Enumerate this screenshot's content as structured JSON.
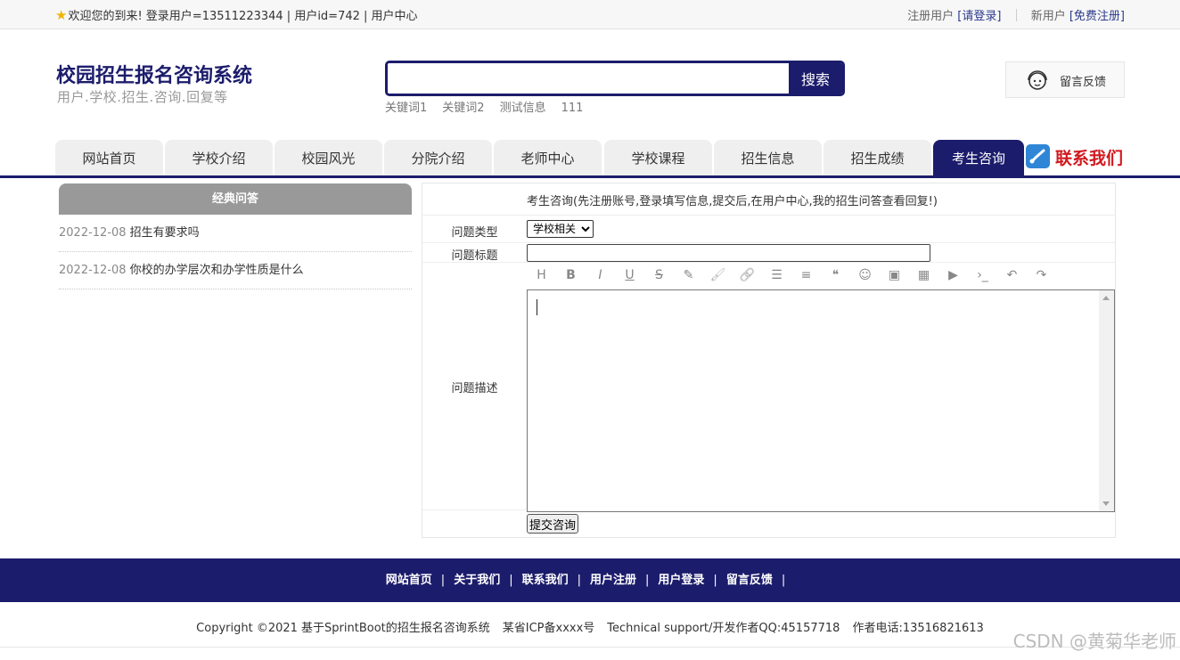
{
  "topbar": {
    "welcome": "欢迎您的到来!  登录用户=13511223344 | 用户id=742 | 用户中心",
    "register_prefix": "注册用户",
    "login_link": "[请登录]",
    "new_user_prefix": "新用户",
    "register_link": "[免费注册]"
  },
  "header": {
    "title": "校园招生报名咨询系统",
    "subtitle": "用户.学校.招生.咨询.回复等",
    "search_button": "搜索",
    "search_value": "",
    "keywords": [
      "关键词1",
      "关键词2",
      "测试信息",
      "111"
    ],
    "feedback_label": "留言反馈"
  },
  "nav": {
    "tabs": [
      "网站首页",
      "学校介绍",
      "校园风光",
      "分院介绍",
      "老师中心",
      "学校课程",
      "招生信息",
      "招生成绩",
      "考生咨询"
    ],
    "active_index": 8,
    "contact_label": "联系我们"
  },
  "sidebar": {
    "heading": "经典问答",
    "items": [
      {
        "date": "2022-12-08",
        "question": "招生有要求吗"
      },
      {
        "date": "2022-12-08",
        "question": "你校的办学层次和办学性质是什么"
      }
    ]
  },
  "form": {
    "intro": "考生咨询(先注册账号,登录填写信息,提交后,在用户中心,我的招生问答查看回复!)",
    "type_label": "问题类型",
    "type_value": "学校相关",
    "title_label": "问题标题",
    "title_value": "",
    "desc_label": "问题描述",
    "toolbar_icons": [
      "heading-icon",
      "bold-icon",
      "italic-icon",
      "underline-icon",
      "strikethrough-icon",
      "highlight-icon",
      "paint-brush-icon",
      "link-icon",
      "unordered-list-icon",
      "align-icon",
      "quote-icon",
      "emoji-icon",
      "image-icon",
      "table-icon",
      "video-icon",
      "code-icon",
      "undo-icon",
      "redo-icon"
    ],
    "toolbar_glyphs": [
      "H",
      "B",
      "I",
      "U",
      "S",
      "✎",
      "🖌",
      "🔗",
      "☰",
      "≡",
      "❝",
      "☺",
      "▣",
      "▦",
      "▶",
      "›_",
      "↶",
      "↷"
    ],
    "submit_label": "提交咨询"
  },
  "footer": {
    "links": [
      "网站首页",
      "关于我们",
      "联系我们",
      "用户注册",
      "用户登录",
      "留言反馈"
    ],
    "copyright": "Copyright ©2021 基于SprintBoot的招生报名咨询系统",
    "icp": "某省ICP备xxxx号",
    "support": "Technical support/开发作者QQ:45157718",
    "phone": "作者电话:13516821613",
    "watermark": "CSDN @黄菊华老师"
  },
  "colors": {
    "brand": "#1c1c6c",
    "contact_red": "#d0191f",
    "sidebar_head": "#999999"
  }
}
